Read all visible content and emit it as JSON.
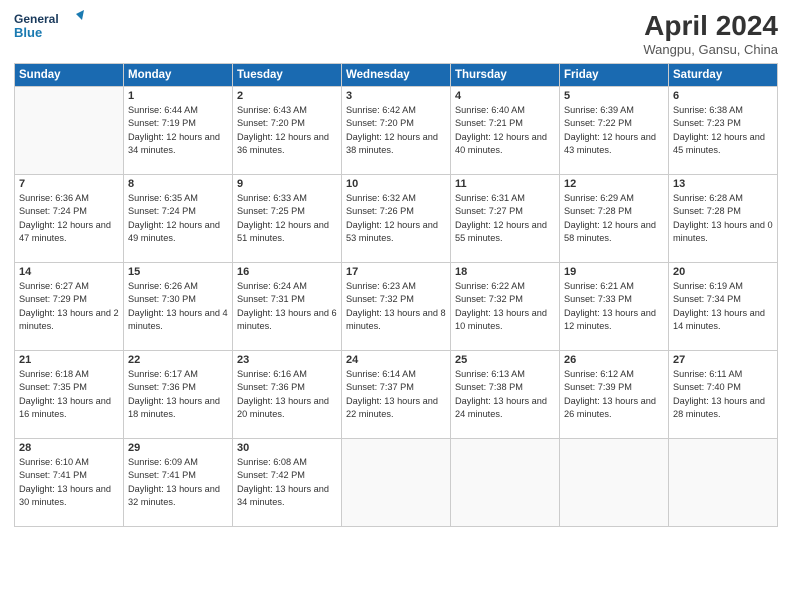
{
  "header": {
    "logo_line1": "General",
    "logo_line2": "Blue",
    "month_title": "April 2024",
    "location": "Wangpu, Gansu, China"
  },
  "weekdays": [
    "Sunday",
    "Monday",
    "Tuesday",
    "Wednesday",
    "Thursday",
    "Friday",
    "Saturday"
  ],
  "weeks": [
    [
      {
        "day": "",
        "sunrise": "",
        "sunset": "",
        "daylight": ""
      },
      {
        "day": "1",
        "sunrise": "Sunrise: 6:44 AM",
        "sunset": "Sunset: 7:19 PM",
        "daylight": "Daylight: 12 hours and 34 minutes."
      },
      {
        "day": "2",
        "sunrise": "Sunrise: 6:43 AM",
        "sunset": "Sunset: 7:20 PM",
        "daylight": "Daylight: 12 hours and 36 minutes."
      },
      {
        "day": "3",
        "sunrise": "Sunrise: 6:42 AM",
        "sunset": "Sunset: 7:20 PM",
        "daylight": "Daylight: 12 hours and 38 minutes."
      },
      {
        "day": "4",
        "sunrise": "Sunrise: 6:40 AM",
        "sunset": "Sunset: 7:21 PM",
        "daylight": "Daylight: 12 hours and 40 minutes."
      },
      {
        "day": "5",
        "sunrise": "Sunrise: 6:39 AM",
        "sunset": "Sunset: 7:22 PM",
        "daylight": "Daylight: 12 hours and 43 minutes."
      },
      {
        "day": "6",
        "sunrise": "Sunrise: 6:38 AM",
        "sunset": "Sunset: 7:23 PM",
        "daylight": "Daylight: 12 hours and 45 minutes."
      }
    ],
    [
      {
        "day": "7",
        "sunrise": "Sunrise: 6:36 AM",
        "sunset": "Sunset: 7:24 PM",
        "daylight": "Daylight: 12 hours and 47 minutes."
      },
      {
        "day": "8",
        "sunrise": "Sunrise: 6:35 AM",
        "sunset": "Sunset: 7:24 PM",
        "daylight": "Daylight: 12 hours and 49 minutes."
      },
      {
        "day": "9",
        "sunrise": "Sunrise: 6:33 AM",
        "sunset": "Sunset: 7:25 PM",
        "daylight": "Daylight: 12 hours and 51 minutes."
      },
      {
        "day": "10",
        "sunrise": "Sunrise: 6:32 AM",
        "sunset": "Sunset: 7:26 PM",
        "daylight": "Daylight: 12 hours and 53 minutes."
      },
      {
        "day": "11",
        "sunrise": "Sunrise: 6:31 AM",
        "sunset": "Sunset: 7:27 PM",
        "daylight": "Daylight: 12 hours and 55 minutes."
      },
      {
        "day": "12",
        "sunrise": "Sunrise: 6:29 AM",
        "sunset": "Sunset: 7:28 PM",
        "daylight": "Daylight: 12 hours and 58 minutes."
      },
      {
        "day": "13",
        "sunrise": "Sunrise: 6:28 AM",
        "sunset": "Sunset: 7:28 PM",
        "daylight": "Daylight: 13 hours and 0 minutes."
      }
    ],
    [
      {
        "day": "14",
        "sunrise": "Sunrise: 6:27 AM",
        "sunset": "Sunset: 7:29 PM",
        "daylight": "Daylight: 13 hours and 2 minutes."
      },
      {
        "day": "15",
        "sunrise": "Sunrise: 6:26 AM",
        "sunset": "Sunset: 7:30 PM",
        "daylight": "Daylight: 13 hours and 4 minutes."
      },
      {
        "day": "16",
        "sunrise": "Sunrise: 6:24 AM",
        "sunset": "Sunset: 7:31 PM",
        "daylight": "Daylight: 13 hours and 6 minutes."
      },
      {
        "day": "17",
        "sunrise": "Sunrise: 6:23 AM",
        "sunset": "Sunset: 7:32 PM",
        "daylight": "Daylight: 13 hours and 8 minutes."
      },
      {
        "day": "18",
        "sunrise": "Sunrise: 6:22 AM",
        "sunset": "Sunset: 7:32 PM",
        "daylight": "Daylight: 13 hours and 10 minutes."
      },
      {
        "day": "19",
        "sunrise": "Sunrise: 6:21 AM",
        "sunset": "Sunset: 7:33 PM",
        "daylight": "Daylight: 13 hours and 12 minutes."
      },
      {
        "day": "20",
        "sunrise": "Sunrise: 6:19 AM",
        "sunset": "Sunset: 7:34 PM",
        "daylight": "Daylight: 13 hours and 14 minutes."
      }
    ],
    [
      {
        "day": "21",
        "sunrise": "Sunrise: 6:18 AM",
        "sunset": "Sunset: 7:35 PM",
        "daylight": "Daylight: 13 hours and 16 minutes."
      },
      {
        "day": "22",
        "sunrise": "Sunrise: 6:17 AM",
        "sunset": "Sunset: 7:36 PM",
        "daylight": "Daylight: 13 hours and 18 minutes."
      },
      {
        "day": "23",
        "sunrise": "Sunrise: 6:16 AM",
        "sunset": "Sunset: 7:36 PM",
        "daylight": "Daylight: 13 hours and 20 minutes."
      },
      {
        "day": "24",
        "sunrise": "Sunrise: 6:14 AM",
        "sunset": "Sunset: 7:37 PM",
        "daylight": "Daylight: 13 hours and 22 minutes."
      },
      {
        "day": "25",
        "sunrise": "Sunrise: 6:13 AM",
        "sunset": "Sunset: 7:38 PM",
        "daylight": "Daylight: 13 hours and 24 minutes."
      },
      {
        "day": "26",
        "sunrise": "Sunrise: 6:12 AM",
        "sunset": "Sunset: 7:39 PM",
        "daylight": "Daylight: 13 hours and 26 minutes."
      },
      {
        "day": "27",
        "sunrise": "Sunrise: 6:11 AM",
        "sunset": "Sunset: 7:40 PM",
        "daylight": "Daylight: 13 hours and 28 minutes."
      }
    ],
    [
      {
        "day": "28",
        "sunrise": "Sunrise: 6:10 AM",
        "sunset": "Sunset: 7:41 PM",
        "daylight": "Daylight: 13 hours and 30 minutes."
      },
      {
        "day": "29",
        "sunrise": "Sunrise: 6:09 AM",
        "sunset": "Sunset: 7:41 PM",
        "daylight": "Daylight: 13 hours and 32 minutes."
      },
      {
        "day": "30",
        "sunrise": "Sunrise: 6:08 AM",
        "sunset": "Sunset: 7:42 PM",
        "daylight": "Daylight: 13 hours and 34 minutes."
      },
      {
        "day": "",
        "sunrise": "",
        "sunset": "",
        "daylight": ""
      },
      {
        "day": "",
        "sunrise": "",
        "sunset": "",
        "daylight": ""
      },
      {
        "day": "",
        "sunrise": "",
        "sunset": "",
        "daylight": ""
      },
      {
        "day": "",
        "sunrise": "",
        "sunset": "",
        "daylight": ""
      }
    ]
  ]
}
